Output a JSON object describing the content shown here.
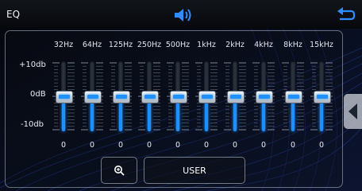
{
  "header": {
    "title": "EQ"
  },
  "icons": {
    "speaker": "speaker-icon",
    "back": "back-arrow-icon",
    "zoom": "zoom-in-icon",
    "side": "chevron-left-icon"
  },
  "scale": {
    "top": "+10db",
    "mid": "0dB",
    "bottom": "-10db"
  },
  "bands": [
    {
      "freq": "32Hz",
      "value": "0"
    },
    {
      "freq": "64Hz",
      "value": "0"
    },
    {
      "freq": "125Hz",
      "value": "0"
    },
    {
      "freq": "250Hz",
      "value": "0"
    },
    {
      "freq": "500Hz",
      "value": "0"
    },
    {
      "freq": "1kHz",
      "value": "0"
    },
    {
      "freq": "2kHz",
      "value": "0"
    },
    {
      "freq": "4kHz",
      "value": "0"
    },
    {
      "freq": "8kHz",
      "value": "0"
    },
    {
      "freq": "15kHz",
      "value": "0"
    }
  ],
  "preset": {
    "label": "USER"
  },
  "colors": {
    "accent": "#1e8fff",
    "background": "#05070d"
  }
}
